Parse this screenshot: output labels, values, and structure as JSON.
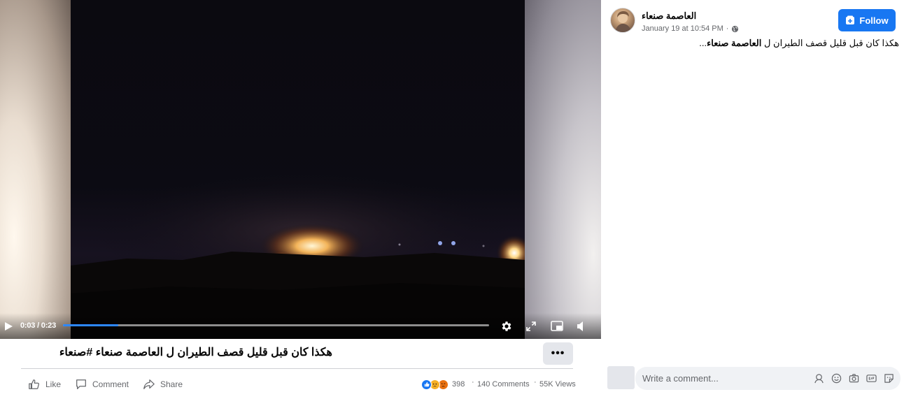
{
  "video": {
    "current_time": "0:03",
    "duration": "0:23",
    "time_label": "0:03 / 0:23",
    "progress_fraction": 0.13
  },
  "post": {
    "caption": "هكذا كان قبل قليل قصف الطيران ل العاصمة صنعاء #صنعاء",
    "more_label": "•••",
    "actions": {
      "like_label": "Like",
      "comment_label": "Comment",
      "share_label": "Share"
    },
    "stats": {
      "reaction_count": "398",
      "comments": "140 Comments",
      "views": "55K Views",
      "separator": "·"
    }
  },
  "sidebar": {
    "page_name": "العاصمة صنعاء",
    "timestamp": "January 19 at 10:54 PM",
    "meta_separator": "·",
    "follow_label": "Follow",
    "post_text_prefix": "هكذا كان قبل قليل قصف الطيران ل",
    "post_text_bold": "العاصمة صنعاء",
    "post_text_suffix": "...",
    "comment_placeholder": "Write a comment..."
  },
  "colors": {
    "brand_blue": "#1877f2",
    "progress_blue": "#2d88ff",
    "secondary_text": "#65676b",
    "button_gray": "#e4e6eb",
    "input_bg": "#f0f2f5"
  },
  "icons": {
    "play": "play-icon",
    "settings": "gear-icon",
    "fullscreen": "expand-icon",
    "pip": "picture-in-picture-icon",
    "volume": "speaker-icon",
    "like": "thumbs-up-icon",
    "comment": "speech-bubble-icon",
    "share": "share-arrow-icon",
    "privacy": "globe-icon",
    "follow": "follow-page-icon"
  }
}
